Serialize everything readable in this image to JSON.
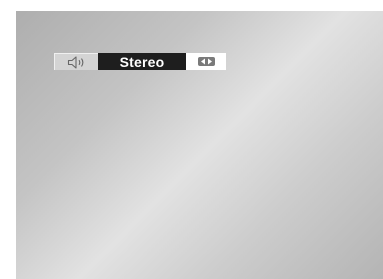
{
  "osd": {
    "speaker_icon": "speaker-icon",
    "mode_label": "Stereo",
    "nav_icon": "left-right-arrows-icon"
  }
}
